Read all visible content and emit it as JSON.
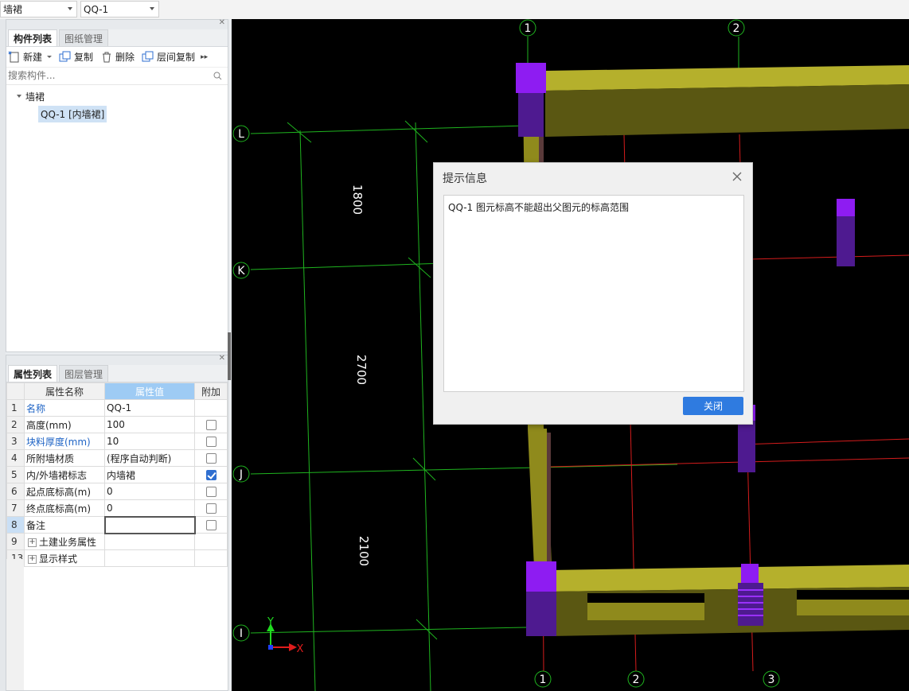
{
  "topbar": {
    "category_select": "墙裙",
    "component_select": "QQ-1"
  },
  "component_panel": {
    "tabs": [
      "构件列表",
      "图纸管理"
    ],
    "toolbar": {
      "new_label": "新建",
      "copy_label": "复制",
      "delete_label": "删除",
      "floor_copy_label": "层间复制"
    },
    "search_placeholder": "搜索构件...",
    "tree": {
      "group_label": "墙裙",
      "items": [
        "QQ-1 [内墙裙]"
      ]
    }
  },
  "property_panel": {
    "tabs": [
      "属性列表",
      "图层管理"
    ],
    "columns": [
      "属性名称",
      "属性值",
      "附加"
    ],
    "rows": [
      {
        "num": "1",
        "name": "名称",
        "value": "QQ-1",
        "checkbox": false
      },
      {
        "num": "2",
        "name": "高度(mm)",
        "value": "100",
        "checkbox": true,
        "checked": false
      },
      {
        "num": "3",
        "name": "块料厚度(mm)",
        "value": "10",
        "checkbox": true,
        "checked": false
      },
      {
        "num": "4",
        "name": "所附墙材质",
        "value": "(程序自动判断)",
        "checkbox": true,
        "checked": false
      },
      {
        "num": "5",
        "name": "内/外墙裙标志",
        "value": "内墙裙",
        "checkbox": true,
        "checked": true
      },
      {
        "num": "6",
        "name": "起点底标高(m)",
        "value": "0",
        "checkbox": true,
        "checked": false
      },
      {
        "num": "7",
        "name": "终点底标高(m)",
        "value": "0",
        "checkbox": true,
        "checked": false
      },
      {
        "num": "8",
        "name": "备注",
        "value": "",
        "checkbox": true,
        "checked": false
      },
      {
        "num": "9",
        "name": "土建业务属性",
        "value": "",
        "checkbox": false,
        "expander": true
      },
      {
        "num": "13",
        "name": "显示样式",
        "value": "",
        "checkbox": false,
        "expander": true
      }
    ]
  },
  "viewport": {
    "axis_top": [
      "1",
      "2"
    ],
    "axis_bottom": [
      "1",
      "2",
      "3"
    ],
    "axis_left": [
      "L",
      "K",
      "J",
      "I"
    ],
    "dimensions": [
      "1800",
      "2700",
      "2100"
    ],
    "gizmo": {
      "x_label": "X",
      "y_label": "Y"
    },
    "colors": {
      "grid": "#1fb41f",
      "axis_red": "#d41c1c",
      "wall": "#8f8a1c",
      "column": "#8e1cf2"
    }
  },
  "dialog": {
    "title": "提示信息",
    "message": "QQ-1 图元标高不能超出父图元的标高范围",
    "close_button": "关闭"
  }
}
